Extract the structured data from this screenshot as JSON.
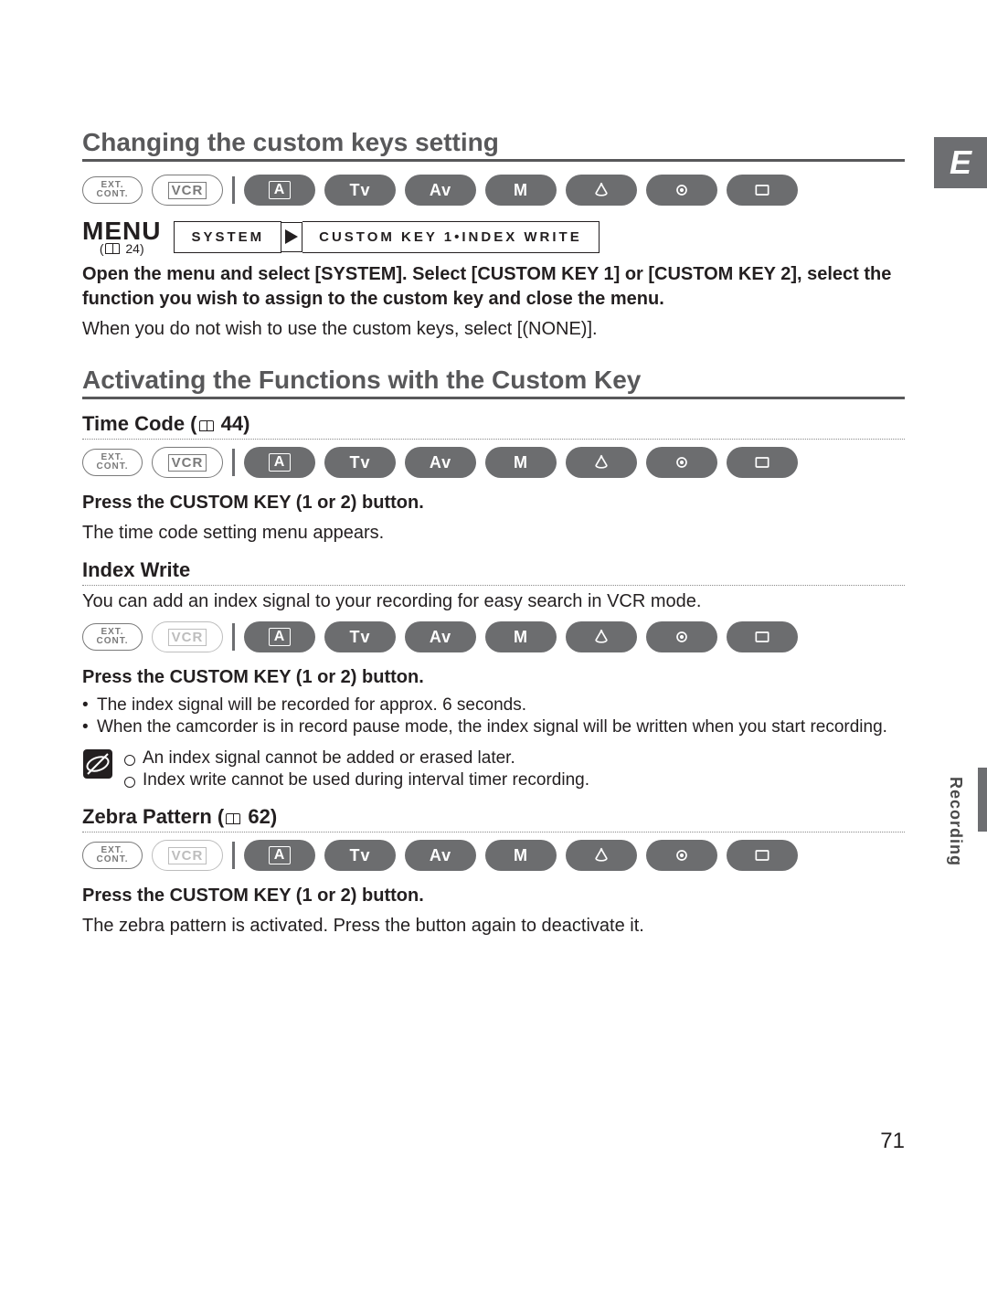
{
  "edge_tab": "E",
  "side_label": "Recording",
  "page_number": "71",
  "section1": {
    "title": "Changing the custom keys setting",
    "menu_label": "MENU",
    "menu_ref": "24",
    "menu_box1": "SYSTEM",
    "menu_box2": "CUSTOM KEY 1•INDEX WRITE",
    "instr_bold": "Open the menu and select [SYSTEM]. Select [CUSTOM KEY 1] or [CUSTOM KEY 2], select the function you wish to assign to the custom key and close the menu.",
    "instr_reg": "When you do not wish to use the custom keys, select [(NONE)]."
  },
  "section2": {
    "title": "Activating the Functions with the Custom Key"
  },
  "timecode": {
    "heading_prefix": "Time Code (",
    "heading_ref": "44)",
    "press": "Press the CUSTOM KEY (1 or 2) button.",
    "desc": "The time code setting menu appears."
  },
  "indexwrite": {
    "heading": "Index Write",
    "intro": "You can add an index signal to your recording for easy search in VCR mode.",
    "press": "Press the CUSTOM KEY (1 or 2) button.",
    "b1": "The index signal will be recorded for approx. 6 seconds.",
    "b2": "When the camcorder is in record pause mode, the index signal will be written when you start recording.",
    "n1": "An index signal cannot be added or erased later.",
    "n2": "Index write cannot be used during interval timer recording."
  },
  "zebra": {
    "heading_prefix": "Zebra Pattern (",
    "heading_ref": "62)",
    "press": "Press the CUSTOM KEY (1 or 2) button.",
    "desc": "The zebra pattern is activated. Press the button again to deactivate it."
  },
  "modes": {
    "ext": "EXT.\nCONT.",
    "vcr": "VCR",
    "a": "A",
    "tv": "Tv",
    "av": "Av",
    "m": "M"
  },
  "row1_active": {
    "tv": true,
    "av": true,
    "m": true,
    "spot": true,
    "night": true,
    "card": true,
    "a": true,
    "vcr": true
  },
  "row2_active": {
    "tv": true,
    "av": true,
    "m": true,
    "spot": true,
    "night": true,
    "card": true,
    "a": true,
    "vcr": true
  },
  "row3_active": {
    "tv": true,
    "av": true,
    "m": true,
    "spot": true,
    "night": true,
    "card": true,
    "a": true,
    "vcr": false
  },
  "row4_active": {
    "tv": true,
    "av": true,
    "m": true,
    "spot": true,
    "night": true,
    "card": true,
    "a": true,
    "vcr": false
  }
}
